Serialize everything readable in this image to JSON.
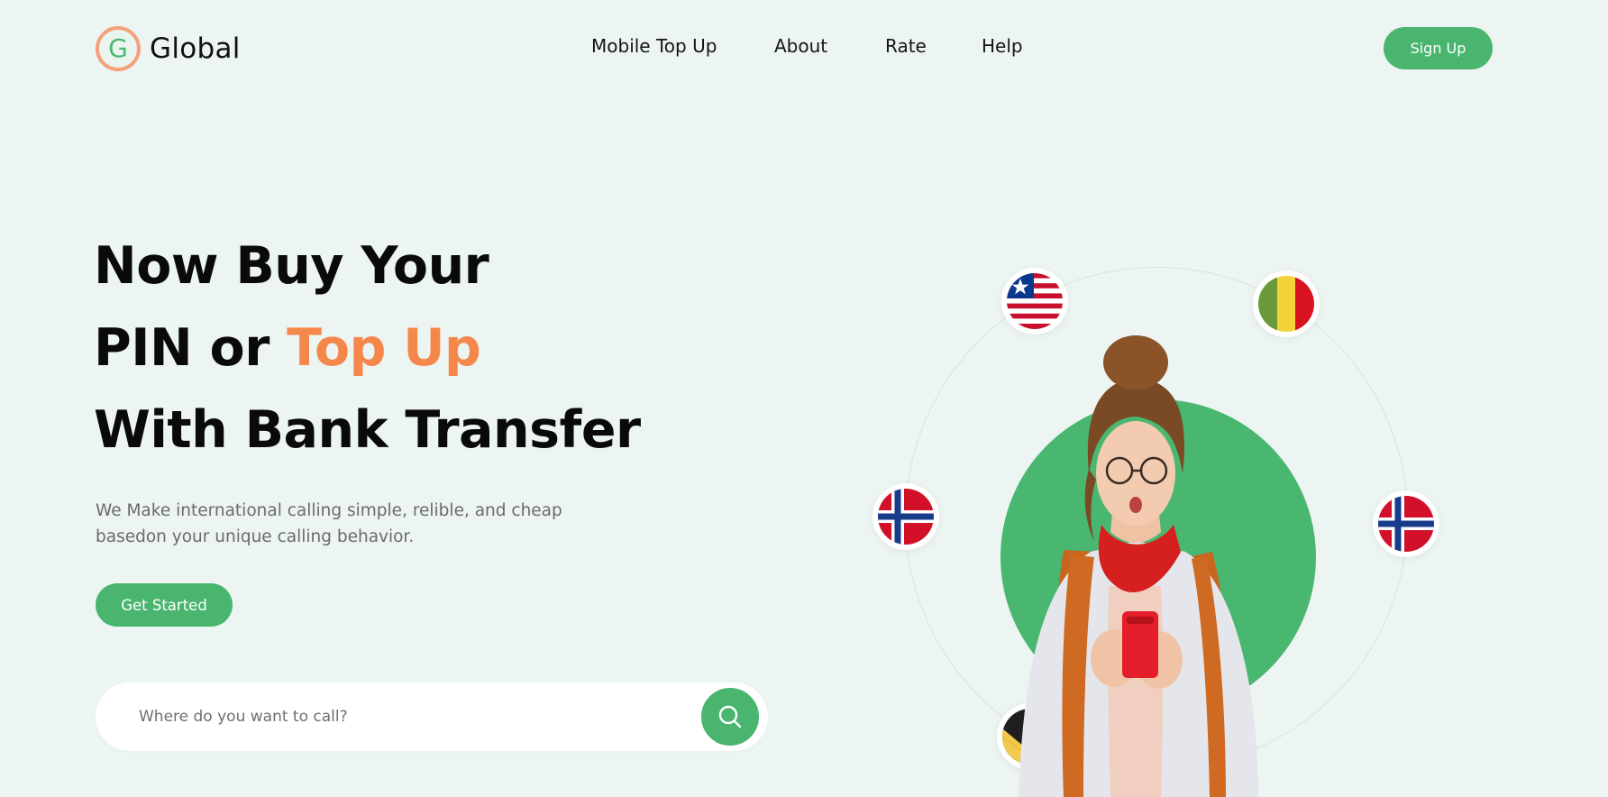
{
  "brand": {
    "initial": "G",
    "name": "Global"
  },
  "nav": {
    "items": [
      {
        "label": "Mobile Top Up"
      },
      {
        "label": "About"
      },
      {
        "label": "Rate"
      },
      {
        "label": "Help"
      }
    ],
    "signup_label": "Sign Up"
  },
  "hero": {
    "line1": "Now Buy Your",
    "line2_prefix": "PIN or ",
    "line2_accent": "Top Up",
    "line3": "With Bank Transfer",
    "subtext_line1": "We Make international calling simple, relible, and cheap",
    "subtext_line2": "basedon your unique calling behavior.",
    "cta_label": "Get Started"
  },
  "search": {
    "placeholder": "Where do you want to call?",
    "value": ""
  },
  "flags": [
    {
      "country": "liberia-flag"
    },
    {
      "country": "mali-flag"
    },
    {
      "country": "norway-flag"
    },
    {
      "country": "norway-flag"
    },
    {
      "country": "partial-flag"
    }
  ],
  "colors": {
    "brand_green": "#49b56e",
    "accent_orange": "#f5874a",
    "background": "#ecf5f1",
    "logo_ring": "#f5a17c"
  }
}
